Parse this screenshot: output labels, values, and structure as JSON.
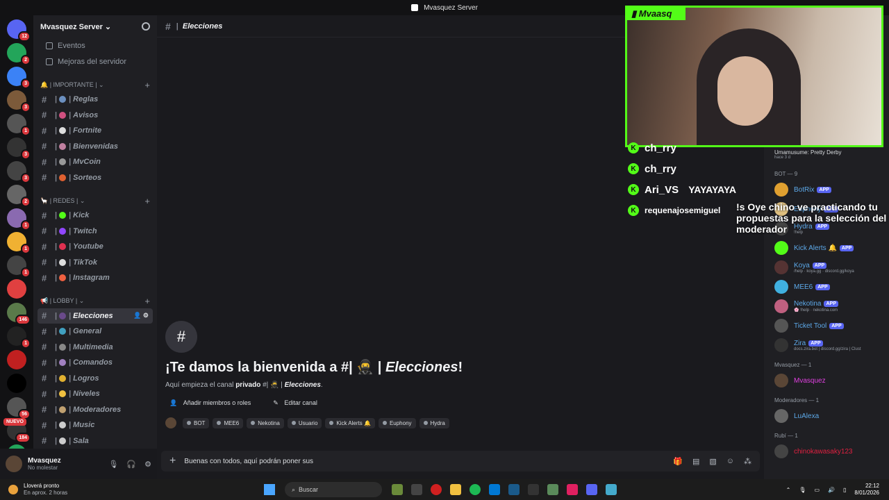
{
  "window": {
    "title": "Mvasquez Server"
  },
  "servers": {
    "items": [
      {
        "name": "discord-home-icon",
        "color": "#5865f2",
        "badge": "12"
      },
      {
        "name": "server-2",
        "color": "#23a55a",
        "badge": "2"
      },
      {
        "name": "server-3",
        "color": "#3b82f6",
        "badge": "3"
      },
      {
        "name": "server-4",
        "color": "#7c5a3a",
        "badge": "3"
      },
      {
        "name": "server-5",
        "color": "#555",
        "badge": "1"
      },
      {
        "name": "server-6",
        "color": "#333",
        "badge": "3"
      },
      {
        "name": "server-7",
        "color": "#444",
        "badge": "3"
      },
      {
        "name": "server-8",
        "color": "#666",
        "badge": "2"
      },
      {
        "name": "server-9",
        "color": "#8a6ab0",
        "badge": "1"
      },
      {
        "name": "server-10",
        "color": "#f0b132",
        "badge": "1"
      },
      {
        "name": "server-11",
        "color": "#444",
        "badge": "1"
      },
      {
        "name": "server-12",
        "color": "#e04040",
        "badge": ""
      },
      {
        "name": "server-13",
        "color": "#5a7a4a",
        "badge": "146"
      },
      {
        "name": "server-14",
        "color": "#222",
        "badge": "1"
      },
      {
        "name": "server-15",
        "color": "#c02020",
        "badge": ""
      },
      {
        "name": "server-16",
        "color": "#000",
        "badge": ""
      },
      {
        "name": "server-17",
        "color": "#555",
        "badge": "56"
      },
      {
        "name": "server-18",
        "color": "#333",
        "badge": "184"
      },
      {
        "name": "server-19",
        "color": "#23a55a",
        "badge": ""
      }
    ],
    "new_label": "NUEVO"
  },
  "sidebar": {
    "server_name": "Mvasquez Server ⌄",
    "top_items": [
      {
        "label": "Eventos"
      },
      {
        "label": "Mejoras del servidor"
      }
    ],
    "categories": [
      {
        "label": "🔔 | IMPORTANTE | ⌄",
        "channels": [
          {
            "name": "Reglas",
            "color": "#6b8fbf"
          },
          {
            "name": "Avisos",
            "color": "#d05080"
          },
          {
            "name": "Fortnite",
            "color": "#dddddd"
          },
          {
            "name": "Bienvenidas",
            "color": "#c080a0"
          },
          {
            "name": "MvCoin",
            "color": "#999999"
          },
          {
            "name": "Sorteos",
            "color": "#e06030"
          }
        ]
      },
      {
        "label": "🦙 | REDES | ⌄",
        "channels": [
          {
            "name": "Kick",
            "color": "#53fc18"
          },
          {
            "name": "Twitch",
            "color": "#9146ff"
          },
          {
            "name": "Youtube",
            "color": "#e03050"
          },
          {
            "name": "TikTok",
            "color": "#dddddd"
          },
          {
            "name": "Instagram",
            "color": "#f06040"
          }
        ]
      },
      {
        "label": "📢 | LOBBY | ⌄",
        "channels": [
          {
            "name": "Elecciones",
            "color": "#6a4a8a",
            "active": true
          },
          {
            "name": "General",
            "color": "#40a0c0"
          },
          {
            "name": "Multimedia",
            "color": "#888888"
          },
          {
            "name": "Comandos",
            "color": "#a080c0"
          },
          {
            "name": "Logros",
            "color": "#e0b030"
          },
          {
            "name": "Niveles",
            "color": "#f0c040"
          },
          {
            "name": "Moderadores",
            "color": "#c0a070"
          },
          {
            "name": "Music",
            "color": "#cccccc"
          },
          {
            "name": "Sala",
            "color": "#cccccc"
          }
        ]
      }
    ]
  },
  "user_panel": {
    "name": "Mvasquez",
    "status": "No molestar"
  },
  "channel": {
    "header_title": "Elecciones",
    "welcome_prefix": "¡Te damos la bienvenida a #| 🥷 |",
    "welcome_channel": "Elecciones",
    "welcome_suffix": "!",
    "sub_prefix": "Aquí empieza el canal",
    "sub_bold": "privado",
    "sub_mid": "#| 🥷 |",
    "sub_channel": "Elecciones",
    "sub_end": ".",
    "add_members": "Añadir miembros o roles",
    "edit_channel": "Editar canal",
    "roles": [
      "BOT",
      "MEE6",
      "Nekotina",
      "Usuario",
      "Kick Alerts 🔔",
      "Euphony",
      "Hydra"
    ]
  },
  "composer": {
    "value": "Buenas con todos, aquí podrán poner sus"
  },
  "members": {
    "top_item": {
      "name": "Umamusume: Pretty Derby",
      "sub": "hace 3 d"
    },
    "bot_header": "BOT — 9",
    "bots": [
      {
        "name": "BotRix",
        "sub": "",
        "color": "#e0a030"
      },
      {
        "name": "Euphony",
        "sub": "",
        "color": "#e0c080"
      },
      {
        "name": "Hydra",
        "sub": "!help",
        "color": "#444"
      },
      {
        "name": "Kick Alerts 🔔",
        "sub": "",
        "color": "#53fc18"
      },
      {
        "name": "Koya",
        "sub": "/help · koya.gg · discord.gg/koya",
        "color": "#553333"
      },
      {
        "name": "MEE6",
        "sub": "",
        "color": "#40b0e0"
      },
      {
        "name": "Nekotina",
        "sub": "🌸 !help · nekotina.com",
        "color": "#c06080"
      },
      {
        "name": "Ticket Tool",
        "sub": "",
        "color": "#555"
      },
      {
        "name": "Zira",
        "sub": "docs.zira.bot | discord.gg/zira | Clust",
        "color": "#333"
      }
    ],
    "app_label": "APP",
    "owner_header": "Mvasquez — 1",
    "owner": {
      "name": "Mvasquez",
      "color": "#e040e0"
    },
    "mods_header": "Moderadores — 1",
    "mod": {
      "name": "LuAlexa",
      "color": "#5da9e9"
    },
    "rubi_header": "Rubí — 1",
    "rubi": {
      "name": "chinokawasaky123",
      "color": "#e02040"
    }
  },
  "stream": {
    "tag": "Mvaasq",
    "chat": [
      {
        "user": "ch_rry",
        "msg": ""
      },
      {
        "user": "ch_rry",
        "msg": ""
      },
      {
        "user": "Ari_VS",
        "msg": "YAYAYAYA"
      },
      {
        "user": "requenajosemiguel",
        "msg": ""
      }
    ],
    "big_message": "!s Oye chino ve practicando tu propuestas para la selección del moderador"
  },
  "taskbar": {
    "weather_title": "Lloverá pronto",
    "weather_sub": "En aprox. 2 horas",
    "search": "Buscar",
    "time": "22:12",
    "date": "8/01/2026"
  }
}
